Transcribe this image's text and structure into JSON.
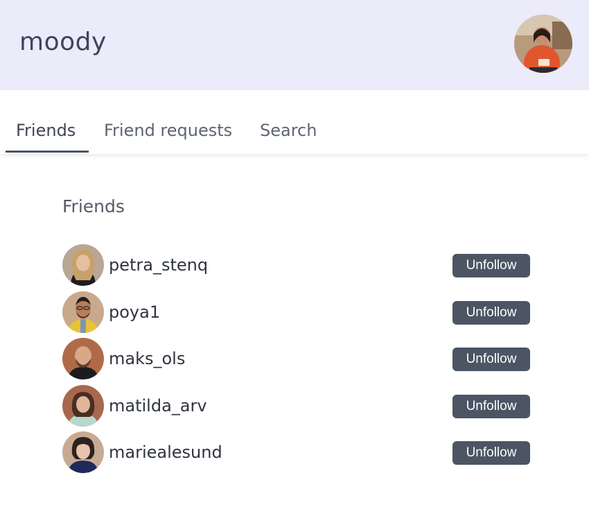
{
  "header": {
    "logo": "moody",
    "user_avatar_icon": "user-avatar-photo"
  },
  "tabs": [
    {
      "label": "Friends",
      "active": true
    },
    {
      "label": "Friend requests",
      "active": false
    },
    {
      "label": "Search",
      "active": false
    }
  ],
  "friends_section": {
    "title": "Friends",
    "unfollow_label": "Unfollow",
    "friends": [
      {
        "username": "petra_stenq",
        "avatar_icon": "avatar-photo"
      },
      {
        "username": "poya1",
        "avatar_icon": "avatar-photo"
      },
      {
        "username": "maks_ols",
        "avatar_icon": "avatar-photo"
      },
      {
        "username": "matilda_arv",
        "avatar_icon": "avatar-photo"
      },
      {
        "username": "mariealesund",
        "avatar_icon": "avatar-photo"
      }
    ]
  },
  "colors": {
    "header_bg": "#ecebfa",
    "button_bg": "#4b5563",
    "button_text": "#ffffff",
    "active_tab_underline": "#4b5563"
  }
}
